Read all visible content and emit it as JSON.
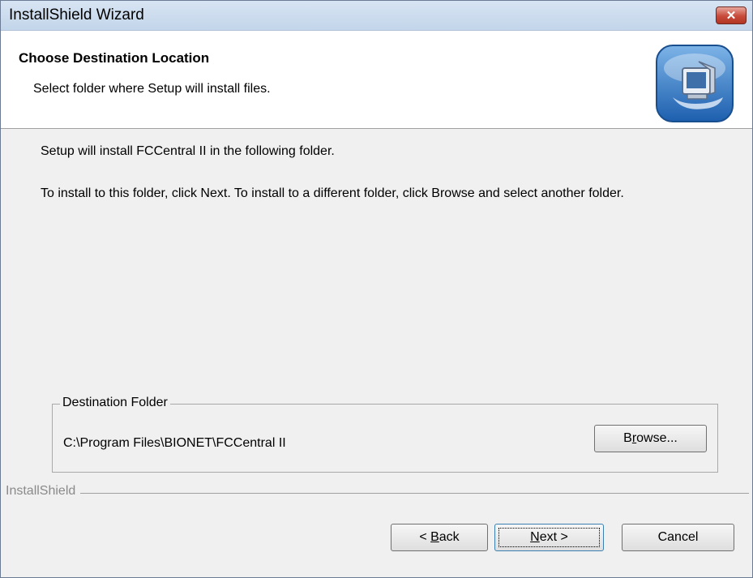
{
  "window": {
    "title": "InstallShield Wizard",
    "close_symbol": "✕"
  },
  "header": {
    "title": "Choose Destination Location",
    "subtitle": "Select folder where Setup will install files.",
    "icon": "installer-computer-icon"
  },
  "body": {
    "line1": "Setup will install FCCentral II in the following folder.",
    "line2": "To install to this folder, click Next. To install to a different folder, click Browse and select another folder."
  },
  "destination": {
    "legend": "Destination Folder",
    "path": "C:\\Program Files\\BIONET\\FCCentral II",
    "browse_pre": "B",
    "browse_u": "r",
    "browse_post": "owse..."
  },
  "brand": "InstallShield",
  "buttons": {
    "back_pre": "< ",
    "back_u": "B",
    "back_post": "ack",
    "next_u": "N",
    "next_post": "ext >",
    "cancel": "Cancel"
  },
  "colors": {
    "window_bg": "#f0f0f0",
    "title_bg": "#c8d8eb",
    "close_red": "#c74a3a"
  }
}
